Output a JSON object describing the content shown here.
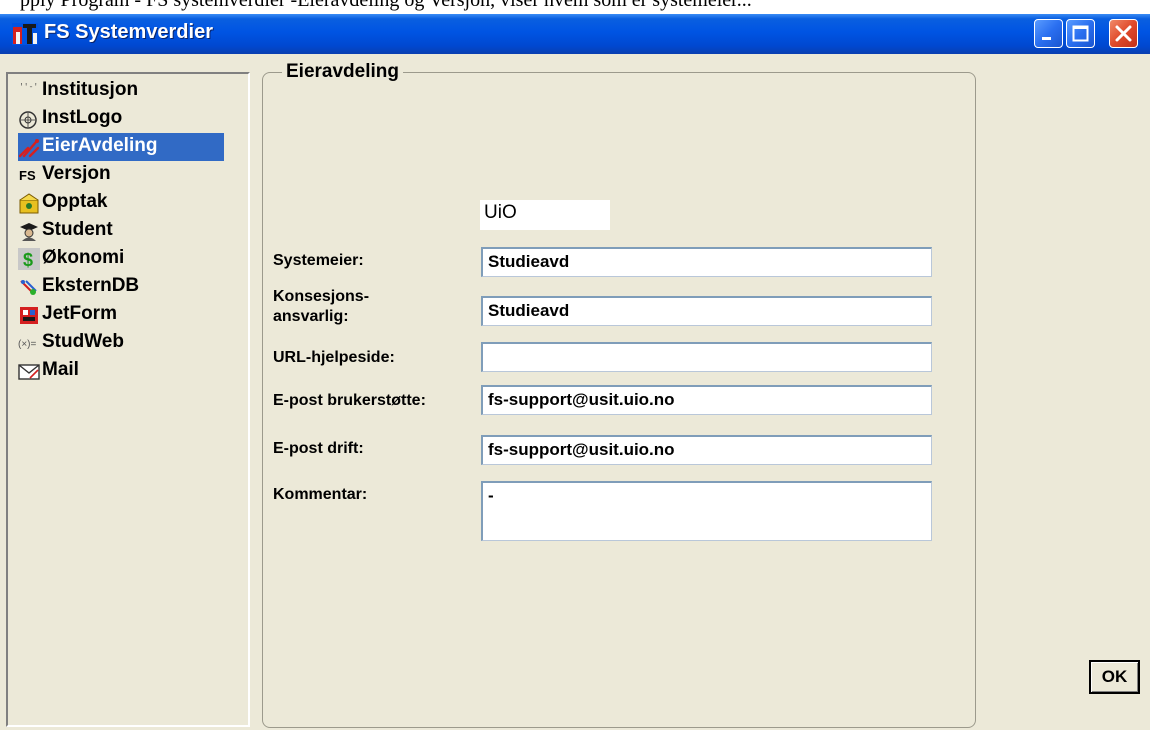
{
  "window": {
    "title": "FS Systemverdier",
    "colors": {
      "titlebar": "#0054e3",
      "selection": "#316ac5",
      "face": "#ece9d8",
      "close": "#e04a2a"
    }
  },
  "top_strip_text": "pply Program - FS systemverdier -Eieravdeling og Versjon, viser hvem som er systemeier...",
  "sidebar": {
    "items": [
      {
        "label": "Institusjon",
        "icon": "institution-icon",
        "selected": false
      },
      {
        "label": "InstLogo",
        "icon": "logo-icon",
        "selected": false
      },
      {
        "label": "EierAvdeling",
        "icon": "owner-department-icon",
        "selected": true
      },
      {
        "label": "Versjon",
        "icon": "fs-version-icon",
        "selected": false
      },
      {
        "label": "Opptak",
        "icon": "admission-icon",
        "selected": false
      },
      {
        "label": "Student",
        "icon": "student-icon",
        "selected": false
      },
      {
        "label": "Økonomi",
        "icon": "dollar-icon",
        "selected": false
      },
      {
        "label": "EksternDB",
        "icon": "external-db-icon",
        "selected": false
      },
      {
        "label": "JetForm",
        "icon": "jetform-icon",
        "selected": false
      },
      {
        "label": "StudWeb",
        "icon": "studweb-icon",
        "selected": false
      },
      {
        "label": "Mail",
        "icon": "mail-icon",
        "selected": false
      }
    ]
  },
  "panel": {
    "title": "Eieravdeling",
    "institution_value": "UiO",
    "fields": {
      "systemeier": {
        "label": "Systemeier:",
        "value": "Studieavd"
      },
      "konsesjon": {
        "label_line1": "Konsesjons-",
        "label_line2": "ansvarlig:",
        "value": "Studieavd"
      },
      "url": {
        "label": "URL-hjelpeside:",
        "value": ""
      },
      "brukerstotte": {
        "label": "E-post brukerstøtte:",
        "value": "fs-support@usit.uio.no"
      },
      "drift": {
        "label": "E-post drift:",
        "value": "fs-support@usit.uio.no"
      },
      "kommentar": {
        "label": "Kommentar:",
        "value": "-"
      }
    }
  },
  "buttons": {
    "ok": "OK"
  }
}
